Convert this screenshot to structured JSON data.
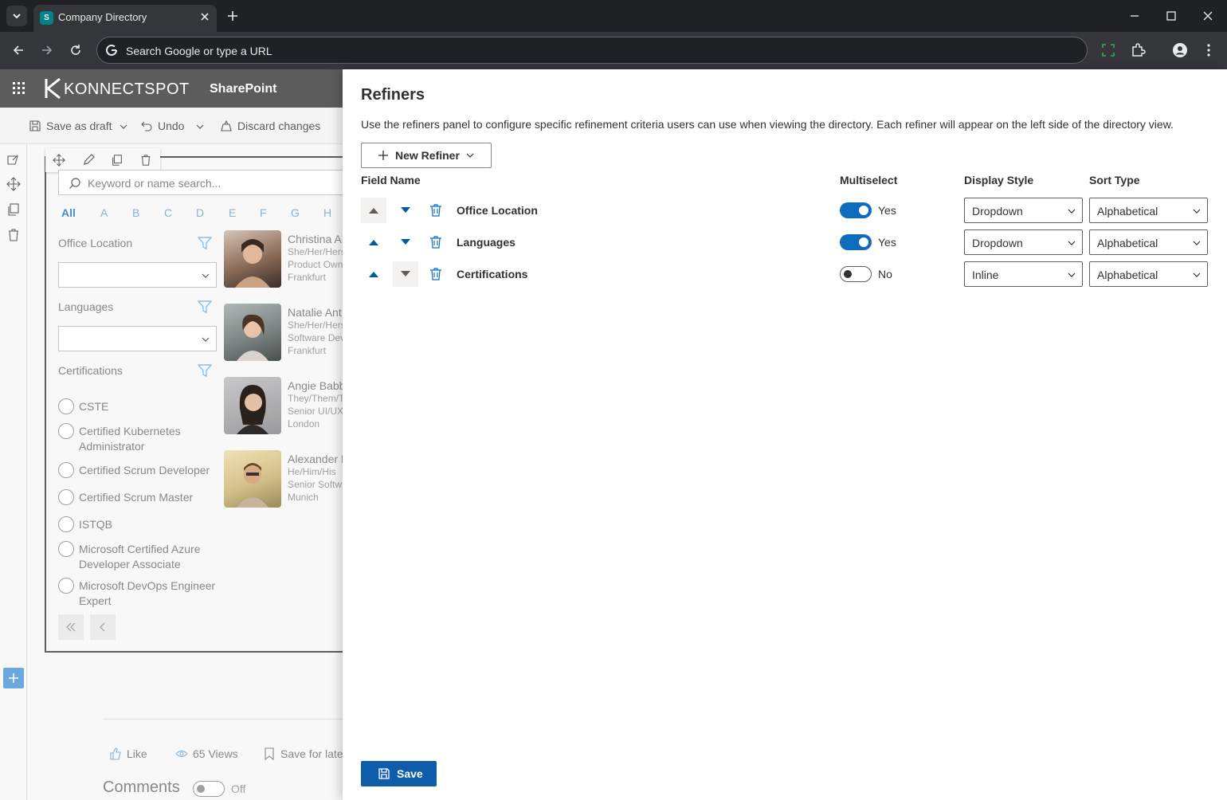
{
  "browser": {
    "tab_title": "Company Directory",
    "favicon_letter": "S",
    "omnibox_placeholder": "Search Google or type a URL"
  },
  "suite": {
    "brand": "KONNECTSPOT",
    "app": "SharePoint"
  },
  "commands": {
    "save_draft": "Save as draft",
    "undo": "Undo",
    "discard": "Discard changes"
  },
  "directory": {
    "search_placeholder": "Keyword or name search...",
    "alphabet": [
      "All",
      "A",
      "B",
      "C",
      "D",
      "E",
      "F",
      "G",
      "H"
    ],
    "refiners": {
      "office_location": "Office Location",
      "languages": "Languages",
      "certifications": "Certifications"
    },
    "certifications": [
      "CSTE",
      "Certified Kubernetes Administrator",
      "Certified Scrum Developer",
      "Certified Scrum Master",
      "ISTQB",
      "Microsoft Certified Azure Developer Associate",
      "Microsoft DevOps Engineer Expert"
    ],
    "people": [
      {
        "name": "Christina A",
        "pronouns": "She/Her/Hers",
        "title": "Product Own",
        "location": "Frankfurt"
      },
      {
        "name": "Natalie Ant",
        "pronouns": "She/Her/Hers",
        "title": "Software Dev",
        "location": "Frankfurt"
      },
      {
        "name": "Angie Babb",
        "pronouns": "They/Them/T",
        "title": "Senior UI/UX",
        "location": "London"
      },
      {
        "name": "Alexander I",
        "pronouns": "He/Him/His",
        "title": "Senior Softw",
        "location": "Munich"
      }
    ]
  },
  "footer": {
    "like": "Like",
    "views": "65 Views",
    "save_later": "Save for late",
    "comments": "Comments",
    "comments_state": "Off"
  },
  "panel": {
    "title": "Refiners",
    "description": "Use the refiners panel to configure specific refinement criteria users can use when viewing the directory. Each refiner will appear on the left side of the directory view.",
    "new_refiner": "New Refiner",
    "columns": {
      "field_name": "Field Name",
      "multiselect": "Multiselect",
      "display_style": "Display Style",
      "sort_type": "Sort Type"
    },
    "rows": [
      {
        "field": "Office Location",
        "multiselect": true,
        "multiselect_label": "Yes",
        "display_style": "Dropdown",
        "sort_type": "Alphabetical"
      },
      {
        "field": "Languages",
        "multiselect": true,
        "multiselect_label": "Yes",
        "display_style": "Dropdown",
        "sort_type": "Alphabetical"
      },
      {
        "field": "Certifications",
        "multiselect": false,
        "multiselect_label": "No",
        "display_style": "Inline",
        "sort_type": "Alphabetical"
      }
    ],
    "save": "Save"
  },
  "colors": {
    "accent": "#0f6cbd",
    "save_button": "#0f5ca8",
    "arrow": "#005a9e"
  },
  "icons": [
    "chevron-down-icon",
    "close-icon",
    "plus-icon",
    "back-arrow-icon",
    "forward-arrow-icon",
    "reload-icon",
    "google-icon",
    "screenshot-icon",
    "extensions-icon",
    "profile-icon",
    "menu-dots-icon",
    "waffle-icon",
    "save-icon",
    "undo-icon",
    "discard-icon",
    "move-icon",
    "edit-icon",
    "duplicate-icon",
    "delete-icon",
    "search-icon",
    "filter-icon",
    "first-page-icon",
    "prev-page-icon",
    "like-icon",
    "views-icon",
    "bookmark-icon",
    "arrow-up-icon",
    "arrow-down-icon",
    "trash-icon"
  ]
}
